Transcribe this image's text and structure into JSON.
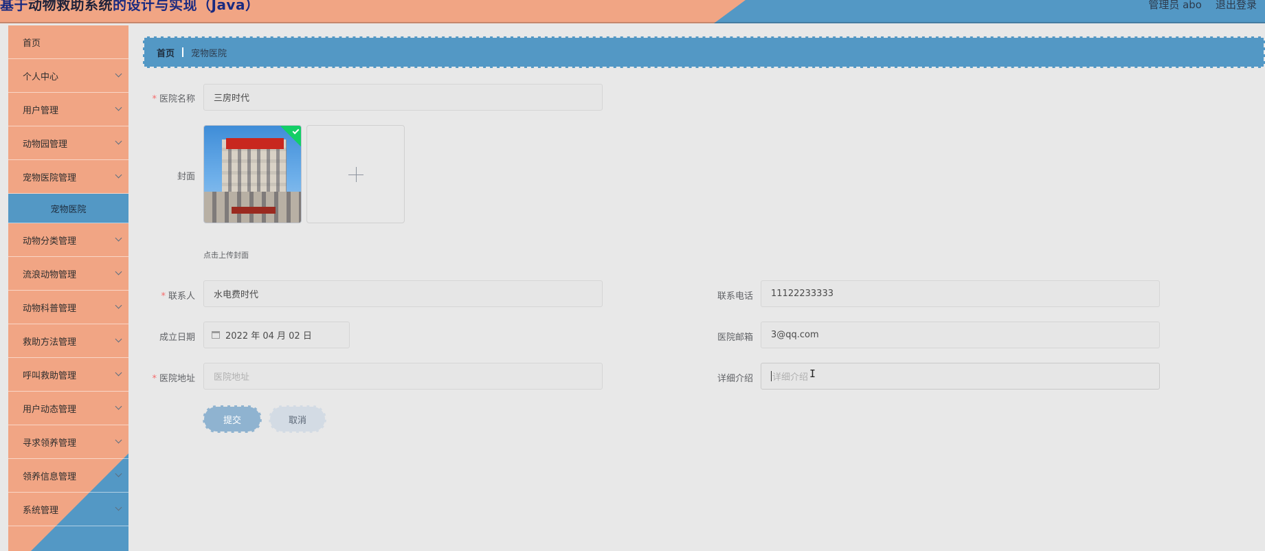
{
  "header": {
    "title_prefix": "基于",
    "title_name": "动物救助系统",
    "title_suffix": "的设计与实现（Java）",
    "user_label": "管理员 abo",
    "logout_label": "退出登录"
  },
  "sidebar": {
    "items": [
      {
        "label": "首页",
        "has_chevron": false
      },
      {
        "label": "个人中心",
        "has_chevron": true
      },
      {
        "label": "用户管理",
        "has_chevron": true
      },
      {
        "label": "动物园管理",
        "has_chevron": true
      },
      {
        "label": "宠物医院管理",
        "has_chevron": true,
        "expanded": true
      }
    ],
    "sub_item": {
      "label": "宠物医院",
      "active": true
    },
    "items_after": [
      {
        "label": "动物分类管理",
        "has_chevron": true
      },
      {
        "label": "流浪动物管理",
        "has_chevron": true
      },
      {
        "label": "动物科普管理",
        "has_chevron": true
      },
      {
        "label": "救助方法管理",
        "has_chevron": true
      },
      {
        "label": "呼叫救助管理",
        "has_chevron": true
      },
      {
        "label": "用户动态管理",
        "has_chevron": true
      },
      {
        "label": "寻求领养管理",
        "has_chevron": true
      },
      {
        "label": "领养信息管理",
        "has_chevron": true
      },
      {
        "label": "系统管理",
        "has_chevron": true
      }
    ]
  },
  "breadcrumb": {
    "home": "首页",
    "current": "宠物医院"
  },
  "form": {
    "hospital_name": {
      "label": "医院名称",
      "value": "三房时代",
      "required": true
    },
    "cover": {
      "label": "封面",
      "upload_tip": "点击上传封面"
    },
    "contact": {
      "label": "联系人",
      "value": "水电费时代",
      "required": true
    },
    "phone": {
      "label": "联系电话",
      "value": "11122233333"
    },
    "founded_date": {
      "label": "成立日期",
      "value": "2022 年 04 月 02 日"
    },
    "email": {
      "label": "医院邮箱",
      "value": "3@qq.com"
    },
    "address": {
      "label": "医院地址",
      "placeholder": "医院地址",
      "required": true
    },
    "detail": {
      "label": "详细介绍",
      "placeholder": "详细介绍"
    },
    "submit_label": "提交",
    "cancel_label": "取消"
  },
  "colors": {
    "accent_blue": "#5398c5",
    "accent_peach": "#f1a584",
    "required_star": "#f56c6c",
    "upload_success": "#13ce66"
  }
}
